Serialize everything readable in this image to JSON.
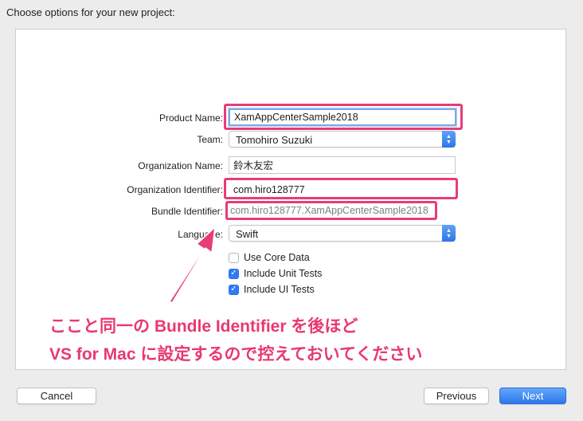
{
  "header": {
    "title": "Choose options for your new project:"
  },
  "form": {
    "product_name": {
      "label": "Product Name:",
      "value": "XamAppCenterSample2018"
    },
    "team": {
      "label": "Team:",
      "value": "Tomohiro Suzuki"
    },
    "organization_name": {
      "label": "Organization Name:",
      "value": "鈴木友宏"
    },
    "organization_identifier": {
      "label": "Organization Identifier:",
      "value": "com.hiro128777"
    },
    "bundle_identifier": {
      "label": "Bundle Identifier:",
      "value": "com.hiro128777.XamAppCenterSample2018"
    },
    "language": {
      "label": "Language:",
      "value": "Swift"
    },
    "checkboxes": [
      {
        "label": "Use Core Data",
        "checked": false
      },
      {
        "label": "Include Unit Tests",
        "checked": true
      },
      {
        "label": "Include UI Tests",
        "checked": true
      }
    ]
  },
  "annotation": {
    "line1": "ここと同一の Bundle Identifier を後ほど",
    "line2": "VS for Mac に設定するので控えておいてください",
    "color": "#e8396f"
  },
  "footer": {
    "cancel_label": "Cancel",
    "previous_label": "Previous",
    "next_label": "Next"
  },
  "colors": {
    "accent": "#2f7cf6",
    "highlight": "#e83c78"
  }
}
